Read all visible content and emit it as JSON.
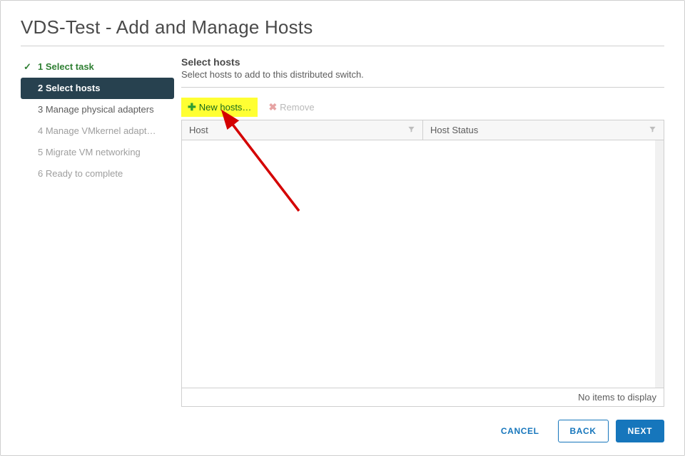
{
  "title": "VDS-Test - Add and Manage Hosts",
  "steps": [
    {
      "label": "1 Select task",
      "state": "done"
    },
    {
      "label": "2 Select hosts",
      "state": "current"
    },
    {
      "label": "3 Manage physical adapters",
      "state": "num"
    },
    {
      "label": "4 Manage VMkernel adapt…",
      "state": "disabled"
    },
    {
      "label": "5 Migrate VM networking",
      "state": "disabled"
    },
    {
      "label": "6 Ready to complete",
      "state": "disabled"
    }
  ],
  "panel": {
    "title": "Select hosts",
    "description": "Select hosts to add to this distributed switch."
  },
  "toolbar": {
    "new_hosts_label": "New hosts…",
    "remove_label": "Remove"
  },
  "grid": {
    "columns": {
      "host": "Host",
      "host_status": "Host Status"
    },
    "empty_text": "No items to display"
  },
  "footer": {
    "cancel": "CANCEL",
    "back": "BACK",
    "next": "NEXT"
  }
}
